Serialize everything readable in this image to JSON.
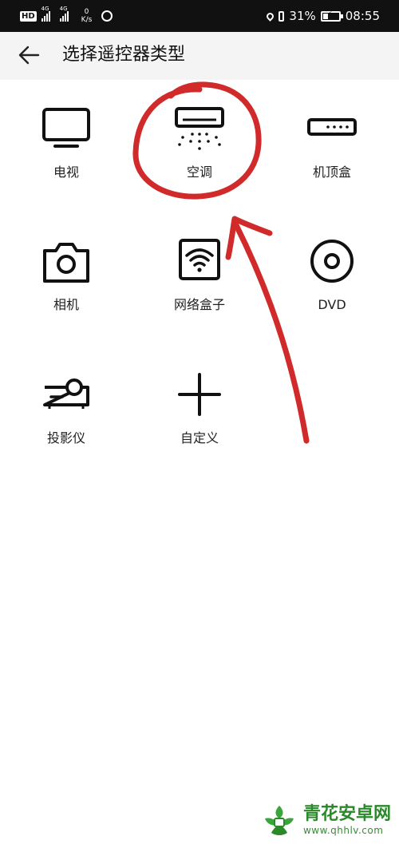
{
  "status_bar": {
    "hd": "HD",
    "net1": "4G",
    "net2": "4G",
    "speed_value": "0",
    "speed_unit": "K/s",
    "battery_percent": "31%",
    "battery_level": 0.31,
    "time": "08:55"
  },
  "header": {
    "title": "选择遥控器类型"
  },
  "devices": [
    {
      "label": "电视",
      "icon": "tv-icon"
    },
    {
      "label": "空调",
      "icon": "air-conditioner-icon"
    },
    {
      "label": "机顶盒",
      "icon": "set-top-box-icon"
    },
    {
      "label": "相机",
      "icon": "camera-icon"
    },
    {
      "label": "网络盒子",
      "icon": "network-box-icon"
    },
    {
      "label": "DVD",
      "icon": "dvd-icon"
    },
    {
      "label": "投影仪",
      "icon": "projector-icon"
    },
    {
      "label": "自定义",
      "icon": "plus-icon"
    }
  ],
  "watermark": {
    "name": "青花安卓网",
    "url": "www.qhhlv.com"
  },
  "colors": {
    "status_bar_bg": "#111111",
    "header_bg": "#f4f4f4",
    "annotation_red": "#d02a2a",
    "watermark_green": "#2a8a2a"
  }
}
